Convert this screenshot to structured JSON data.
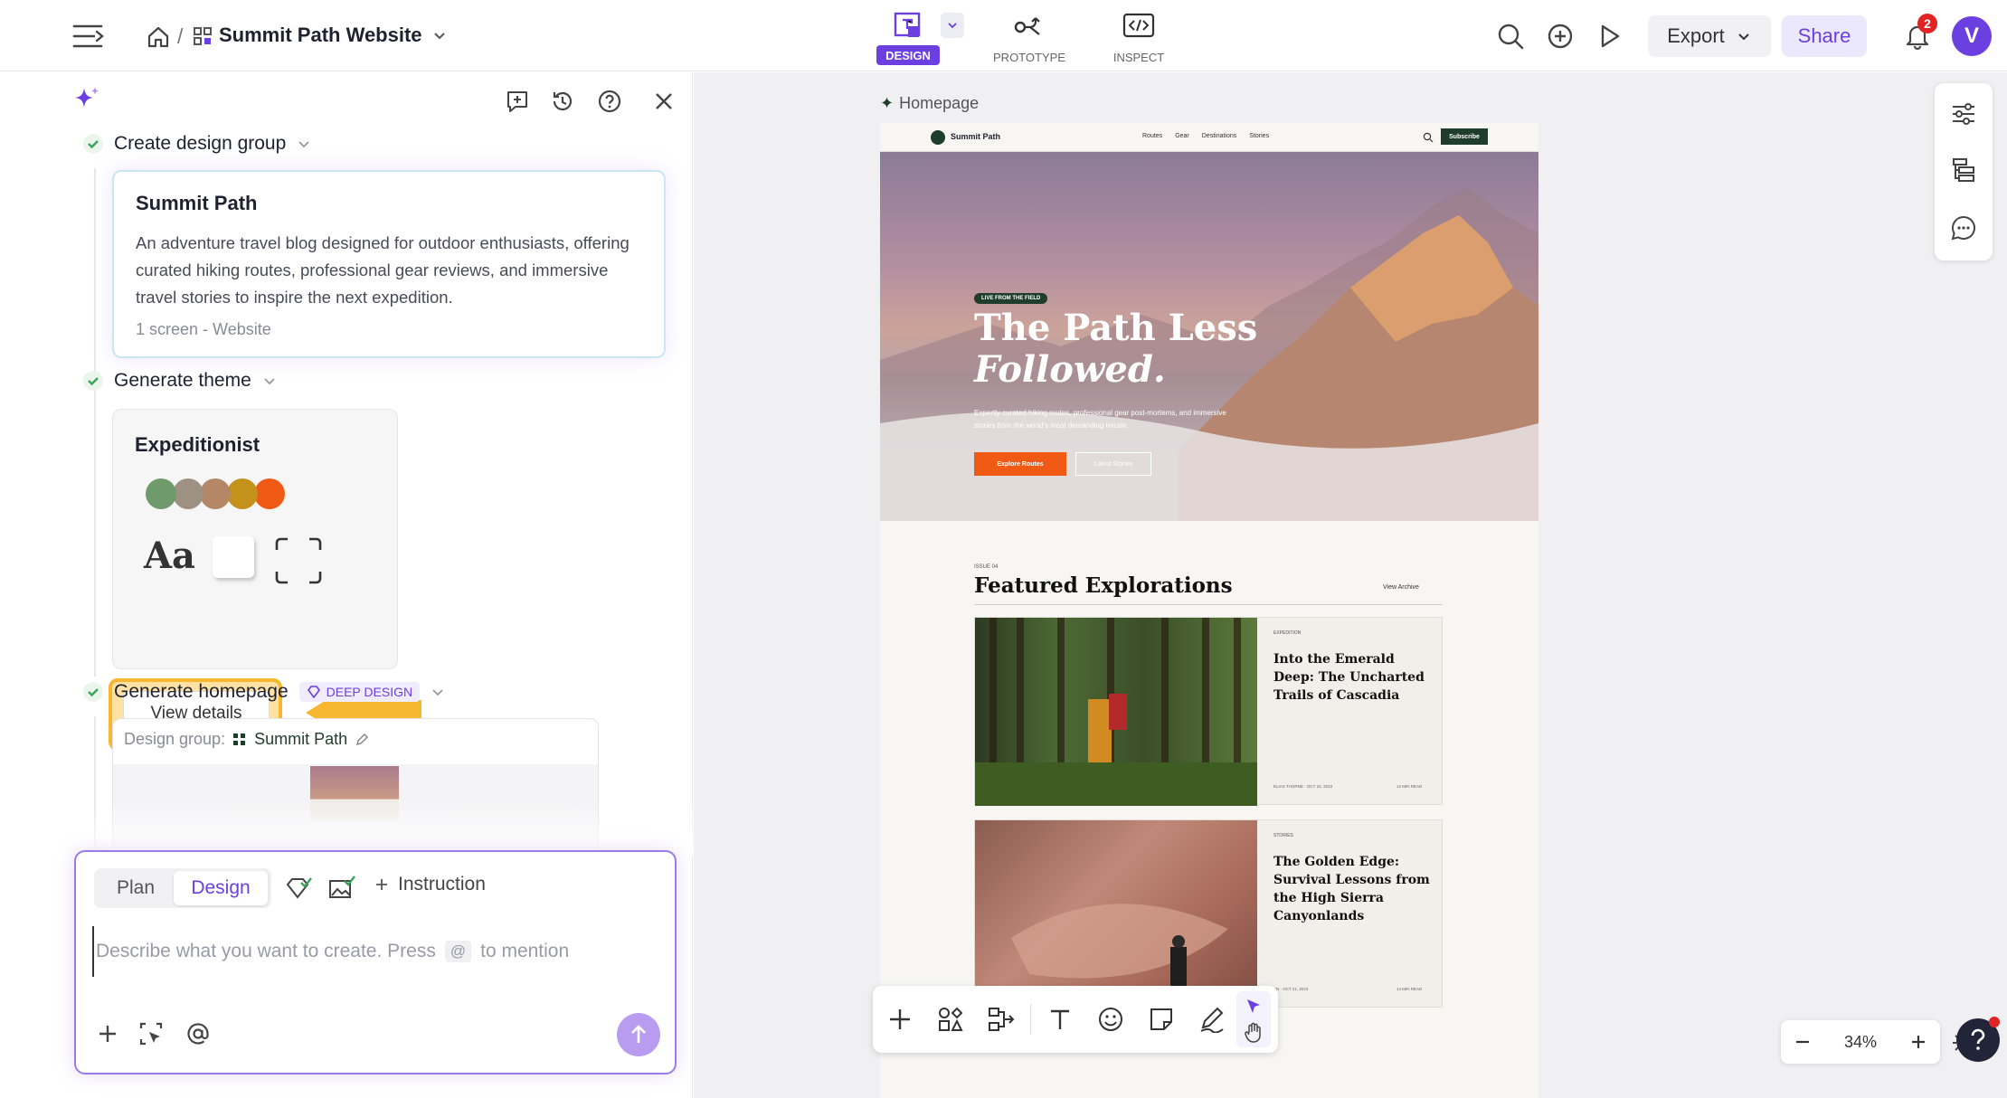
{
  "header": {
    "breadcrumb_sep": "/",
    "project_name": "Summit Path Website",
    "modes": [
      {
        "label": "DESIGN",
        "active": true
      },
      {
        "label": "PROTOTYPE",
        "active": false
      },
      {
        "label": "INSPECT",
        "active": false
      }
    ],
    "export_label": "Export",
    "share_label": "Share",
    "notification_count": "2",
    "avatar_letter": "V"
  },
  "chat": {
    "steps": {
      "group": {
        "label": "Create design group",
        "card_title": "Summit Path",
        "card_desc": "An adventure travel blog designed for outdoor enthusiasts, offering curated hiking routes, professional gear reviews, and immersive travel stories to inspire the next expedition.",
        "card_meta": "1 screen - Website"
      },
      "theme": {
        "label": "Generate theme",
        "card_title": "Expeditionist",
        "swatches": [
          "#6f9a6c",
          "#9c9182",
          "#b48866",
          "#c4921a",
          "#f05a14"
        ],
        "font_sample": "Aa",
        "view_details": "View details"
      },
      "homepage": {
        "label": "Generate homepage",
        "badge": "DEEP DESIGN",
        "group_prefix": "Design group:",
        "group_name": "Summit Path"
      }
    },
    "composer": {
      "tab_plan": "Plan",
      "tab_design": "Design",
      "instruction": "Instruction",
      "placeholder_a": "Describe what you want to create. Press",
      "at_key": "@",
      "placeholder_b": "to mention"
    }
  },
  "canvas": {
    "frame_label": "Homepage",
    "zoom": "34%"
  },
  "site": {
    "brand": "Summit Path",
    "nav": [
      "Routes",
      "Gear",
      "Destinations",
      "Stories"
    ],
    "subscribe": "Subscribe",
    "hero_tag": "LIVE FROM THE FIELD",
    "hero_title_1": "The Path Less",
    "hero_title_2": "Followed.",
    "hero_sub": "Expertly curated hiking routes, professional gear post-mortems, and immersive stories from the world's most demanding terrain.",
    "cta_primary": "Explore Routes",
    "cta_secondary": "Latest Stories",
    "issue": "ISSUE 04",
    "featured_title": "Featured Explorations",
    "view_archive": "View Archive",
    "articles": [
      {
        "tag": "EXPEDITION",
        "title": "Into the Emerald Deep: The Uncharted Trails of Cascadia",
        "author": "ELIAS THORNE · OCT 24, 2023",
        "read": "12 MIN READ"
      },
      {
        "tag": "STORIES",
        "title": "The Golden Edge: Survival Lessons from the High Sierra Canyonlands",
        "author": "SN · OCT 21, 2023",
        "read": "14 MIN READ"
      }
    ]
  },
  "colors": {
    "accent": "#6b3fe0",
    "success": "#3aa35c",
    "highlight": "#f7b731",
    "cta": "#f05a14",
    "site_dark": "#1f3d2b"
  }
}
